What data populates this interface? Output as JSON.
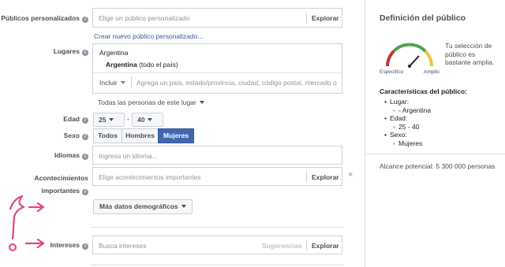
{
  "form": {
    "custom_audiences": {
      "label": "Públicos personalizados",
      "placeholder": "Elige un público personalizado",
      "browse": "Explorar",
      "create_link": "Crear nuevo público personalizado..."
    },
    "locations": {
      "label": "Lugares",
      "country_header": "Argentina",
      "selected_bold": "Argentina",
      "selected_rest": " (todo el país)",
      "include_label": "Incluir",
      "placeholder": "Agrega un país, estado/provincia, ciudad, código postal, mercado o d",
      "people_dropdown": "Todas las personas de este lugar"
    },
    "age": {
      "label": "Edad",
      "min": "25",
      "max": "40",
      "dash": "-"
    },
    "gender": {
      "label": "Sexo",
      "options": [
        "Todos",
        "Hombres",
        "Mujeres"
      ],
      "selected": "Mujeres"
    },
    "languages": {
      "label": "Idiomas",
      "placeholder": "Ingresa un idioma..."
    },
    "life_events": {
      "label_line1": "Acontecimientos",
      "label_line2": "importantes",
      "placeholder": "Elige acontecimientos importantes",
      "browse": "Explorar",
      "remove": "×"
    },
    "more_demographics": {
      "label": "Más datos demográficos"
    },
    "interests": {
      "label": "Intereses",
      "placeholder": "Busca intereses",
      "suggestions": "Sugerencias",
      "browse": "Explorar"
    }
  },
  "audience_panel": {
    "title": "Definición del público",
    "gauge_left": "Específico",
    "gauge_right": "Amplio",
    "gauge_text": "Tu selección de público es bastante amplia.",
    "characteristics_title": "Características del público:",
    "location_label": "Lugar:",
    "location_value": "- Argentina",
    "age_label": "Edad:",
    "age_value": "25 - 40",
    "gender_label": "Sexo:",
    "gender_value": "Mujeres",
    "potential_reach": "Alcance potencial: 5 300 000 personas"
  },
  "colors": {
    "accent": "#4267b2",
    "annotation": "#e0467c",
    "gauge_red": "#c7332e",
    "gauge_yellow": "#e8c547",
    "gauge_green": "#4aa44a"
  }
}
